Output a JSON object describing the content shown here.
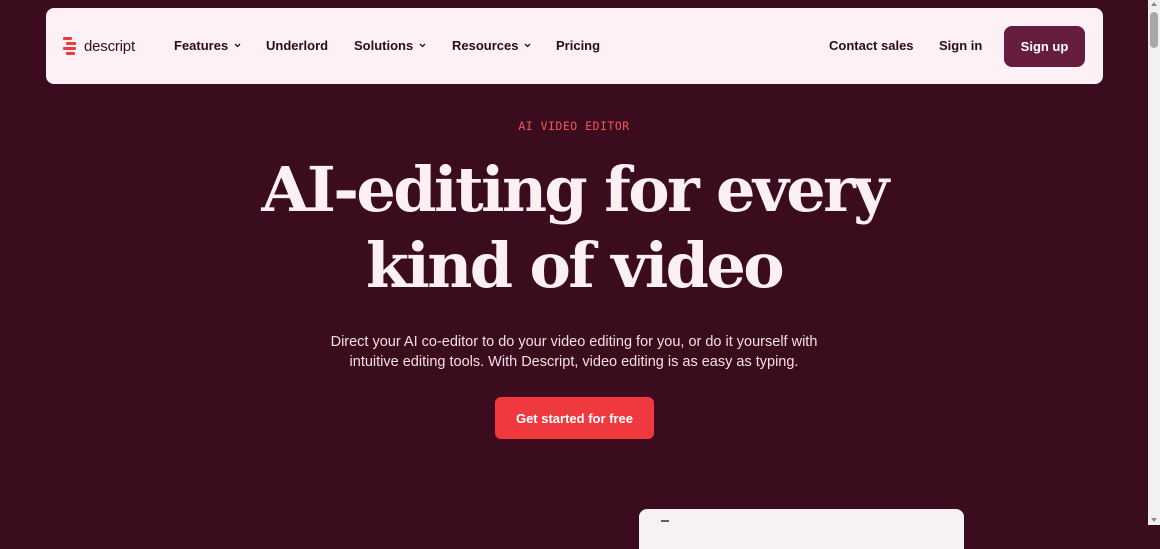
{
  "nav": {
    "logo_text": "descript",
    "items": [
      {
        "label": "Features",
        "dropdown": true
      },
      {
        "label": "Underlord",
        "dropdown": false
      },
      {
        "label": "Solutions",
        "dropdown": true
      },
      {
        "label": "Resources",
        "dropdown": true
      },
      {
        "label": "Pricing",
        "dropdown": false
      }
    ],
    "contact_sales": "Contact sales",
    "sign_in": "Sign in",
    "sign_up": "Sign up"
  },
  "hero": {
    "eyebrow": "AI VIDEO EDITOR",
    "headline_line1": "AI-editing for every",
    "headline_line2": "kind of video",
    "subtext_line1": "Direct your AI co-editor to do your video editing for you, or do it yourself with",
    "subtext_line2": "intuitive editing tools. With Descript, video editing is as easy as typing.",
    "cta": "Get started for free"
  },
  "colors": {
    "background": "#3b0b1e",
    "nav_background": "#fdf1f5",
    "accent_red": "#f0393f",
    "eyebrow": "#f0575c",
    "signup_button": "#661c3f",
    "headline": "#fcf0f2"
  },
  "icons": {
    "logo": "descript-logo-icon",
    "dropdown": "chevron-down-icon"
  }
}
